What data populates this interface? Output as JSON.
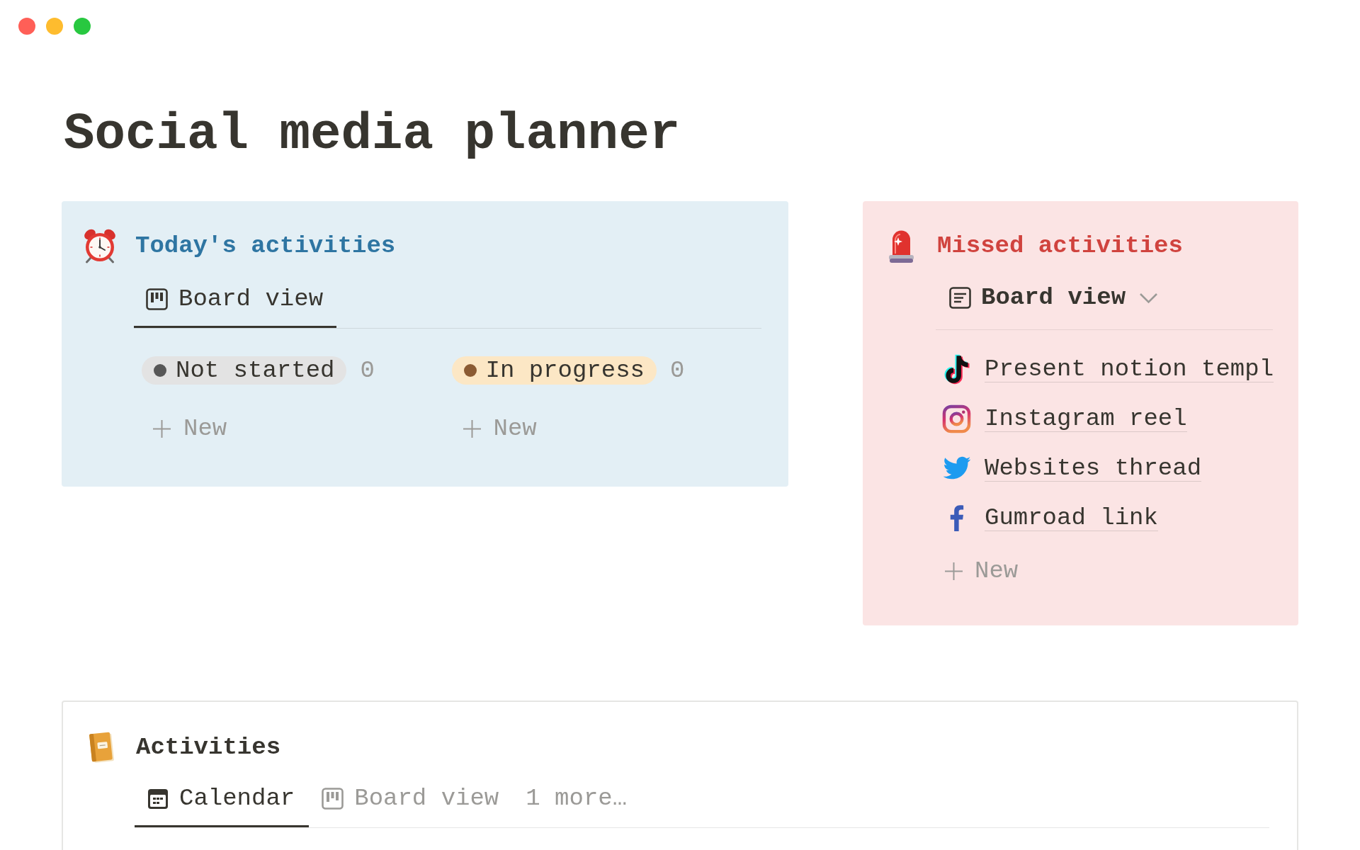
{
  "title": "Social media planner",
  "today": {
    "heading": "Today's activities",
    "tabs": [
      {
        "label": "Board view",
        "kind": "board",
        "selected": true
      }
    ],
    "columns": [
      {
        "status": "Not started",
        "color": "#575757",
        "count": "0",
        "add_label": "New"
      },
      {
        "status": "In progress",
        "color": "#8b5b33",
        "count": "0",
        "add_label": "New"
      }
    ]
  },
  "missed": {
    "heading": "Missed activities",
    "view": {
      "label": "Board view",
      "kind": "list"
    },
    "items": [
      {
        "kind": "note",
        "title": "Present notion templ"
      },
      {
        "kind": "camera",
        "title": "Instagram reel"
      },
      {
        "kind": "bird",
        "title": "Websites thread"
      },
      {
        "kind": "letter",
        "title": "Gumroad link"
      }
    ],
    "add_label": "New"
  },
  "activities": {
    "heading": "Activities",
    "tabs": [
      {
        "label": "Calendar",
        "kind": "calendar",
        "selected": true
      },
      {
        "label": "Board view",
        "kind": "board",
        "selected": false
      },
      {
        "label": "1 more…",
        "kind": "more",
        "selected": false
      }
    ]
  }
}
